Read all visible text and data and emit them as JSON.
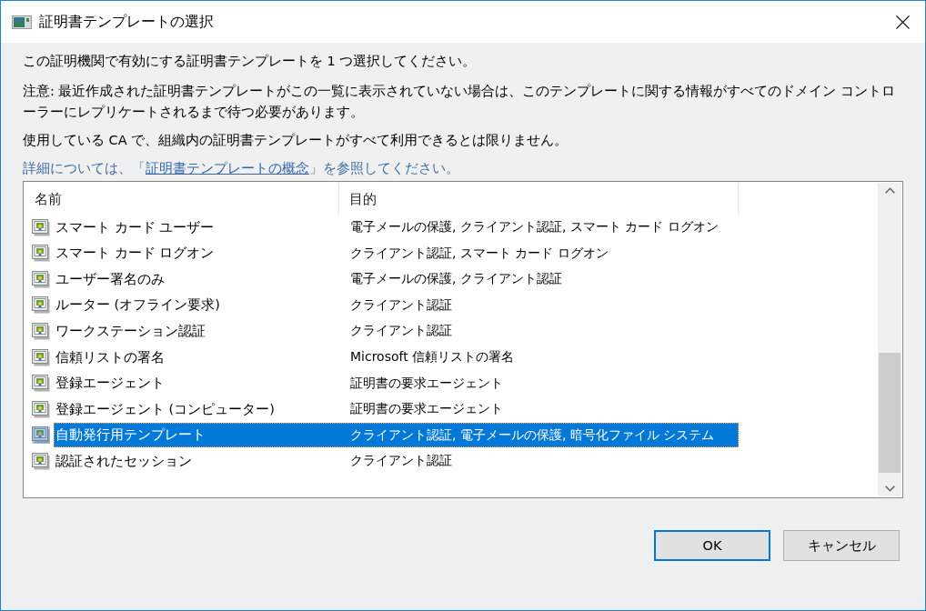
{
  "window": {
    "title": "証明書テンプレートの選択"
  },
  "intro": "この証明機関で有効にする証明書テンプレートを 1 つ選択してください。",
  "note": "注意: 最近作成された証明書テンプレートがこの一覧に表示されていない場合は、このテンプレートに関する情報がすべてのドメイン コントローラーにレプリケートされるまで待つ必要があります。",
  "ca_notice": "使用している CA で、組織内の証明書テンプレートがすべて利用できるとは限りません。",
  "help_link": {
    "before": "詳細については、「",
    "link": "証明書テンプレートの概念",
    "after": "」を参照してください。"
  },
  "list": {
    "columns": [
      "名前",
      "目的"
    ],
    "rows": [
      {
        "name": "スマート カード ユーザー",
        "purpose": "電子メールの保護, クライアント認証, スマート カード ログオン",
        "selected": false
      },
      {
        "name": "スマート カード ログオン",
        "purpose": "クライアント認証, スマート カード ログオン",
        "selected": false
      },
      {
        "name": "ユーザー署名のみ",
        "purpose": "電子メールの保護, クライアント認証",
        "selected": false
      },
      {
        "name": "ルーター (オフライン要求)",
        "purpose": "クライアント認証",
        "selected": false
      },
      {
        "name": "ワークステーション認証",
        "purpose": "クライアント認証",
        "selected": false
      },
      {
        "name": "信頼リストの署名",
        "purpose": "Microsoft 信頼リストの署名",
        "selected": false
      },
      {
        "name": "登録エージェント",
        "purpose": "証明書の要求エージェント",
        "selected": false
      },
      {
        "name": "登録エージェント (コンピューター)",
        "purpose": "証明書の要求エージェント",
        "selected": false
      },
      {
        "name": "自動発行用テンプレート",
        "purpose": "クライアント認証, 電子メールの保護, 暗号化ファイル システム",
        "selected": true
      },
      {
        "name": "認証されたセッション",
        "purpose": "クライアント認証",
        "selected": false
      }
    ]
  },
  "buttons": [
    {
      "label": "OK",
      "default": true
    },
    {
      "label": "キャンセル",
      "default": false
    }
  ]
}
